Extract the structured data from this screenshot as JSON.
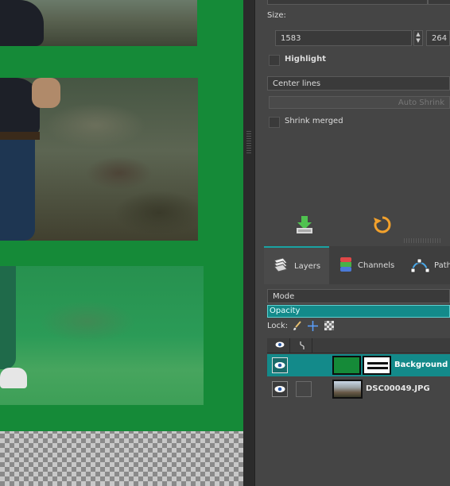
{
  "tool_options": {
    "size_label": "Size:",
    "width_value": "1583",
    "height_value": "264",
    "highlight_label": "Highlight",
    "guides_value": "Center lines",
    "auto_shrink_label": "Auto Shrink",
    "shrink_merged_label": "Shrink merged"
  },
  "actions": {
    "save_icon": "save-download-icon",
    "reset_icon": "reset-icon"
  },
  "tabs": [
    {
      "label": "Layers",
      "icon": "layers-icon"
    },
    {
      "label": "Channels",
      "icon": "channels-icon"
    },
    {
      "label": "Paths",
      "icon": "paths-icon"
    }
  ],
  "layers_panel": {
    "mode_label": "Mode",
    "opacity_label": "Opacity",
    "lock_label": "Lock:",
    "layers": [
      {
        "name": "Background",
        "selected": true
      },
      {
        "name": "DSC00049.JPG",
        "selected": false
      }
    ]
  },
  "colors": {
    "accent": "#1a9a9a",
    "canvas_green": "#158a38"
  }
}
